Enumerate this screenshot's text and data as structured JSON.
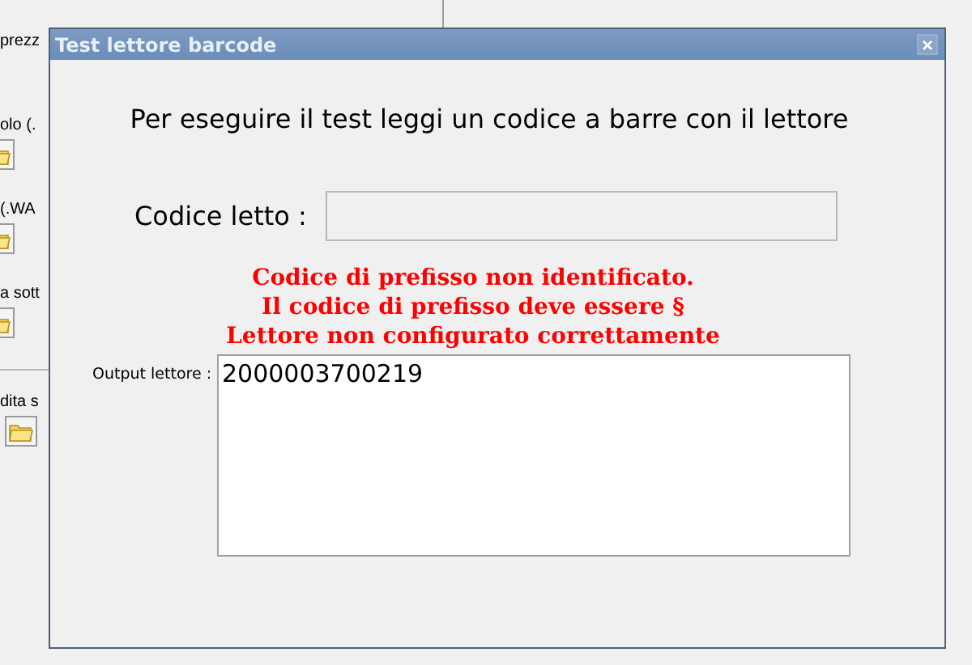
{
  "background": {
    "labels": [
      {
        "text": "prezz",
        "folder": false
      },
      {
        "text": "olo (.",
        "folder": true
      },
      {
        "text": "(.WA",
        "folder": true
      },
      {
        "text": "a sott",
        "folder": true
      },
      {
        "text": "dita s",
        "folder": true
      }
    ]
  },
  "dialog": {
    "title": "Test lettore barcode",
    "close": "×",
    "instruction": "Per eseguire il test leggi un codice a barre con il lettore",
    "code_label": "Codice letto :",
    "errors": [
      "Codice di prefisso non identificato.",
      "Il codice di prefisso deve essere §",
      "Lettore non configurato correttamente"
    ],
    "output_label": "Output lettore :",
    "output_value": "2000003700219"
  }
}
